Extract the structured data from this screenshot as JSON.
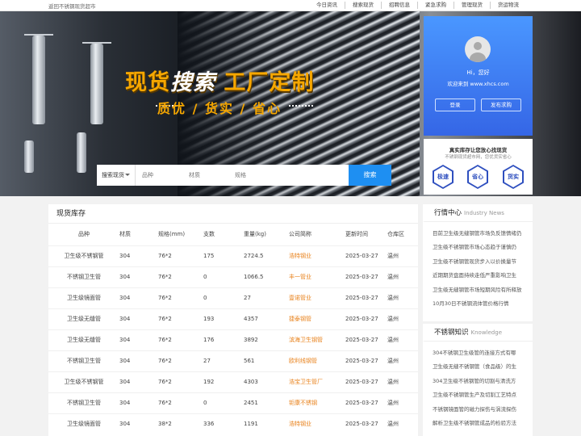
{
  "topbar": {
    "back": "返回不锈钢现货超市",
    "links": [
      "今日资讯",
      "搜索现货",
      "招聘信息",
      "紧急求购",
      "管理现货",
      "货运物流"
    ]
  },
  "banner": {
    "headline_a": "现货",
    "headline_b": "搜索",
    "headline_c": "工厂定制",
    "sub": "质优 / 货实 / 省心"
  },
  "search": {
    "select": "搜索现货",
    "fields": [
      "品种",
      "材质",
      "规格"
    ],
    "button": "搜索"
  },
  "login": {
    "hi": "Hi，您好",
    "welcome": "欢迎来到 www.xhcs.com",
    "login_btn": "登录",
    "post_btn": "发布求购"
  },
  "promo": {
    "title": "真实库存让您放心找现货",
    "subtitle": "不锈钢现货超市网，您优货实省心",
    "badges": [
      "极速",
      "省心",
      "货实"
    ]
  },
  "stock": {
    "title": "现货库存",
    "headers": [
      "品种",
      "材质",
      "规格(mm)",
      "支数",
      "重量(kg)",
      "公司简称",
      "更新时间",
      "仓库区"
    ],
    "rows": [
      [
        "卫生级不锈钢管",
        "304",
        "76*2",
        "175",
        "2724.5",
        "浩特钢业",
        "2025-03-27",
        "温州"
      ],
      [
        "不锈钢卫生管",
        "304",
        "76*2",
        "0",
        "1066.5",
        "丰一管业",
        "2025-03-27",
        "温州"
      ],
      [
        "卫生级镜面管",
        "304",
        "76*2",
        "0",
        "27",
        "壹诺管业",
        "2025-03-27",
        "温州"
      ],
      [
        "卫生级无缝管",
        "304",
        "76*2",
        "193",
        "4357",
        "捷泰钢管",
        "2025-03-27",
        "温州"
      ],
      [
        "卫生级无缝管",
        "304",
        "76*2",
        "176",
        "3892",
        "滨海卫生钢管",
        "2025-03-27",
        "温州"
      ],
      [
        "不锈钢卫生管",
        "304",
        "76*2",
        "27",
        "561",
        "欧利线钢管",
        "2025-03-27",
        "温州"
      ],
      [
        "卫生级不锈钢管",
        "304",
        "76*2",
        "192",
        "4303",
        "浩宝卫生管厂",
        "2025-03-27",
        "温州"
      ],
      [
        "不锈钢卫生管",
        "304",
        "76*2",
        "0",
        "2451",
        "钜康不锈钢",
        "2025-03-27",
        "温州"
      ],
      [
        "卫生级镜面管",
        "304",
        "38*2",
        "336",
        "1191",
        "浩特钢业",
        "2025-03-27",
        "温州"
      ]
    ]
  },
  "news": {
    "title": "行情中心",
    "en": "Industry News",
    "items": [
      "目前卫生级无缝钢管市场负反馈情绪仍",
      "卫生级不锈钢管市场心态趋于谨慎仍",
      "卫生级不锈钢管现货步入以价换量节",
      "近期期货盘面持续走低严重影响卫生",
      "卫生级无缝钢管市场短期风险有所释放",
      "10月30日不锈钢流体管价格行情"
    ]
  },
  "knowledge": {
    "title": "不锈钢知识",
    "en": "Knowledge",
    "items": [
      "304不锈钢卫生级管的连接方式有哪",
      "卫生级无缝不锈钢管（食品级）的生",
      "304卫生级不锈钢管的切割与清洗方",
      "卫生级不锈钢管生产及切割工艺特点",
      "不锈钢镜面管的磁力探伤与涡流探伤",
      "解析卫生级不锈钢管成品的检验方法"
    ]
  }
}
